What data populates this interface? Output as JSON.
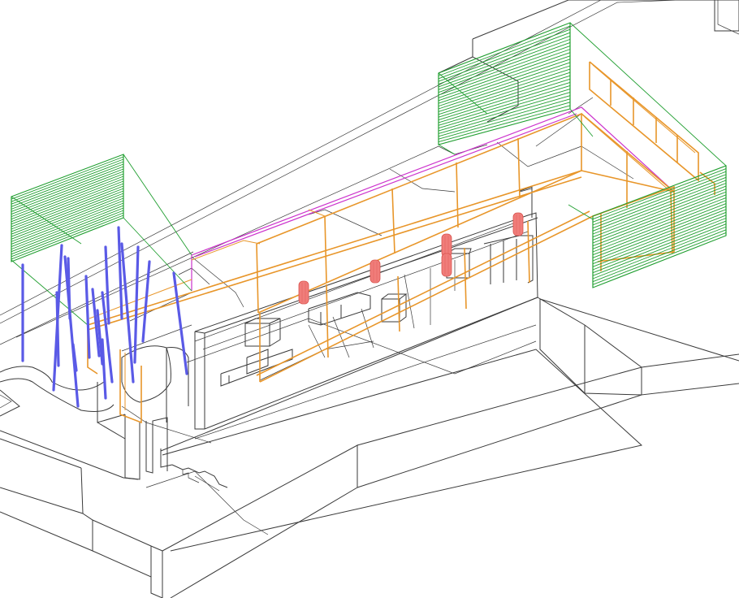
{
  "drawing": {
    "view": "isometric-wireframe",
    "colors": {
      "background": "#ffffff",
      "ink": "#3a3a3a",
      "orange": "#e8962a",
      "green": "#1f9e2f",
      "magenta": "#cc33cc",
      "blue": "#5a5ae6",
      "red": "#f07d7a"
    },
    "layers": [
      {
        "name": "structure-lines",
        "color": "ink"
      },
      {
        "name": "glazing-frames",
        "color": "orange"
      },
      {
        "name": "louvre-screens",
        "color": "green"
      },
      {
        "name": "roof-edge",
        "color": "magenta"
      },
      {
        "name": "tree-trunks",
        "color": "blue"
      },
      {
        "name": "pendant-lights",
        "color": "red"
      }
    ]
  }
}
